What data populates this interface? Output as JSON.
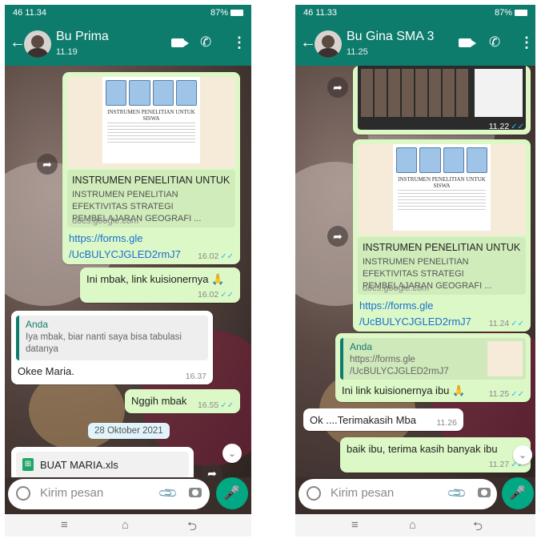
{
  "left": {
    "status": {
      "left": "46 11.34",
      "battery": "87%"
    },
    "contact": {
      "name": "Bu Prima",
      "time": "11.19"
    },
    "preview_title": "INSTRUMEN PENELITIAN UNTUK SISWA",
    "link_msg": {
      "title": "INSTRUMEN PENELITIAN UNTUK ...",
      "desc": "INSTRUMEN PENELITIAN EFEKTIVITAS STRATEGI PEMBELAJARAN GEOGRAFI ...",
      "domain": "docs.google.com",
      "url1": "https://forms.gle",
      "url2": "/UcBULYCJGLED2rmJ7",
      "time": "16.02"
    },
    "msg2": {
      "text": "Ini mbak, link kuisionernya 🙏",
      "time": "16.02"
    },
    "reply": {
      "quote_name": "Anda",
      "quote_text": "Iya mbak, biar nanti saya bisa tabulasi datanya",
      "text": "Okee Maria.",
      "time": "16.37"
    },
    "msg3": {
      "text": "Nggih mbak",
      "time": "16.55"
    },
    "date_chip": "28 Oktober 2021",
    "file": {
      "name": "BUAT MARIA.xls"
    },
    "input_placeholder": "Kirim pesan"
  },
  "right": {
    "status": {
      "left": "46 11.33",
      "battery": "87%"
    },
    "contact": {
      "name": "Bu Gina SMA 3",
      "time": "11.25"
    },
    "img_time": "11.22",
    "preview_title": "INSTRUMEN PENELITIAN UNTUK SISWA",
    "link_msg": {
      "title": "INSTRUMEN PENELITIAN UNTUK ...",
      "desc": "INSTRUMEN PENELITIAN EFEKTIVITAS STRATEGI PEMBELAJARAN GEOGRAFI ...",
      "domain": "docs.google.com",
      "url1": "https://forms.gle",
      "url2": "/UcBULYCJGLED2rmJ7",
      "time": "11.24"
    },
    "reply": {
      "quote_name": "Anda",
      "quote_text": "https://forms.gle /UcBULYCJGLED2rmJ7",
      "text": "Ini link kuisionernya ibu 🙏",
      "time": "11.25"
    },
    "msg_in": {
      "text": "Ok ....Terimakasih Mba",
      "time": "11.26"
    },
    "msg_out": {
      "text": "baik ibu, terima kasih banyak ibu",
      "time": "11.27"
    },
    "input_placeholder": "Kirim pesan"
  },
  "colors": {
    "header": "#0e7c6d",
    "outgoing": "#dcf8c6",
    "incoming": "#ffffff",
    "mic": "#00a884",
    "tick": "#34b7f1"
  }
}
